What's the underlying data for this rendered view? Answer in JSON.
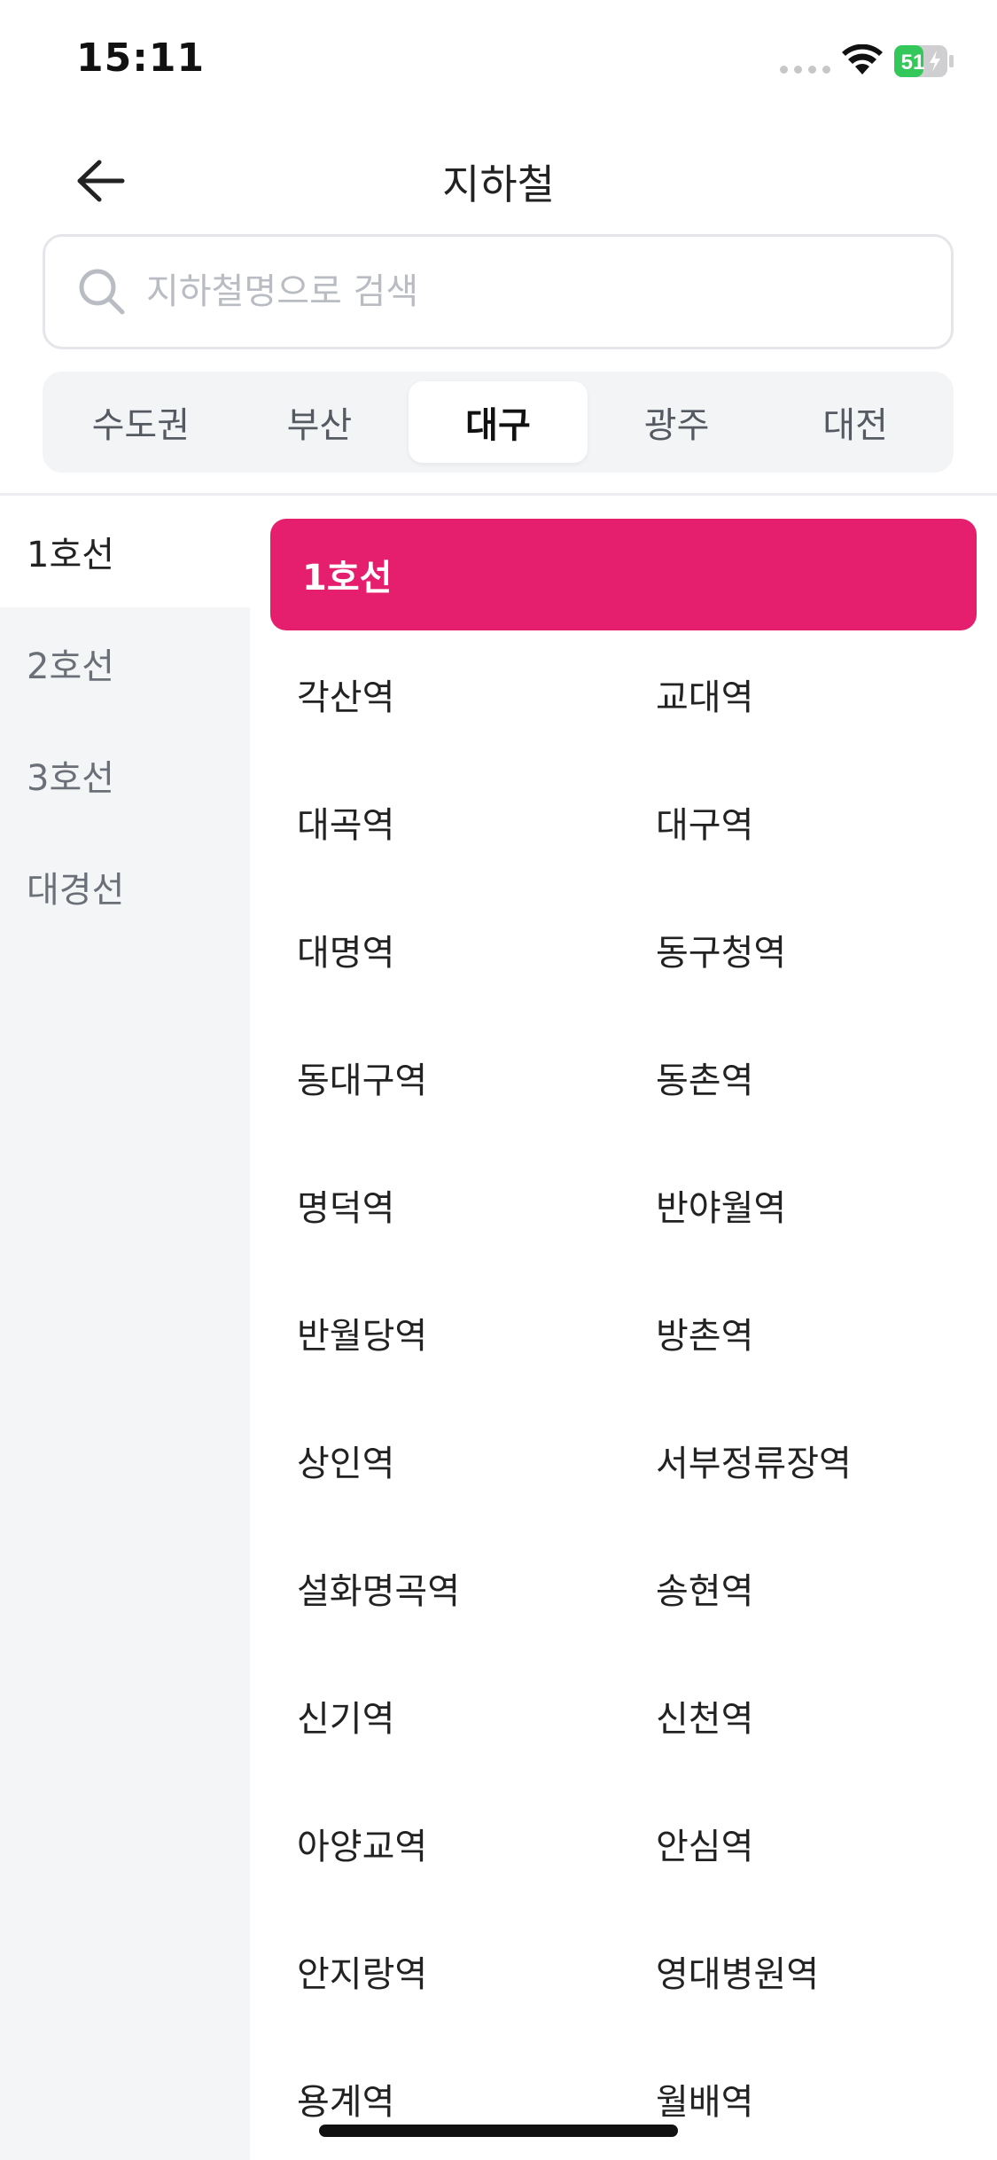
{
  "status_bar": {
    "time": "15:11",
    "battery": "51"
  },
  "header": {
    "title": "지하철"
  },
  "search": {
    "placeholder": "지하철명으로 검색",
    "value": ""
  },
  "region_tabs": [
    {
      "label": "수도권",
      "active": false
    },
    {
      "label": "부산",
      "active": false
    },
    {
      "label": "대구",
      "active": true
    },
    {
      "label": "광주",
      "active": false
    },
    {
      "label": "대전",
      "active": false
    }
  ],
  "lines": [
    {
      "label": "1호선",
      "active": true
    },
    {
      "label": "2호선",
      "active": false
    },
    {
      "label": "3호선",
      "active": false
    },
    {
      "label": "대경선",
      "active": false
    }
  ],
  "selected_line": {
    "label": "1호선",
    "color": "#e61e6e"
  },
  "stations": [
    "각산역",
    "교대역",
    "대곡역",
    "대구역",
    "대명역",
    "동구청역",
    "동대구역",
    "동촌역",
    "명덕역",
    "반야월역",
    "반월당역",
    "방촌역",
    "상인역",
    "서부정류장역",
    "설화명곡역",
    "송현역",
    "신기역",
    "신천역",
    "아양교역",
    "안심역",
    "안지랑역",
    "영대병원역",
    "용계역",
    "월배역"
  ],
  "colors": {
    "accent": "#e61e6e",
    "battery": "#34c759"
  }
}
